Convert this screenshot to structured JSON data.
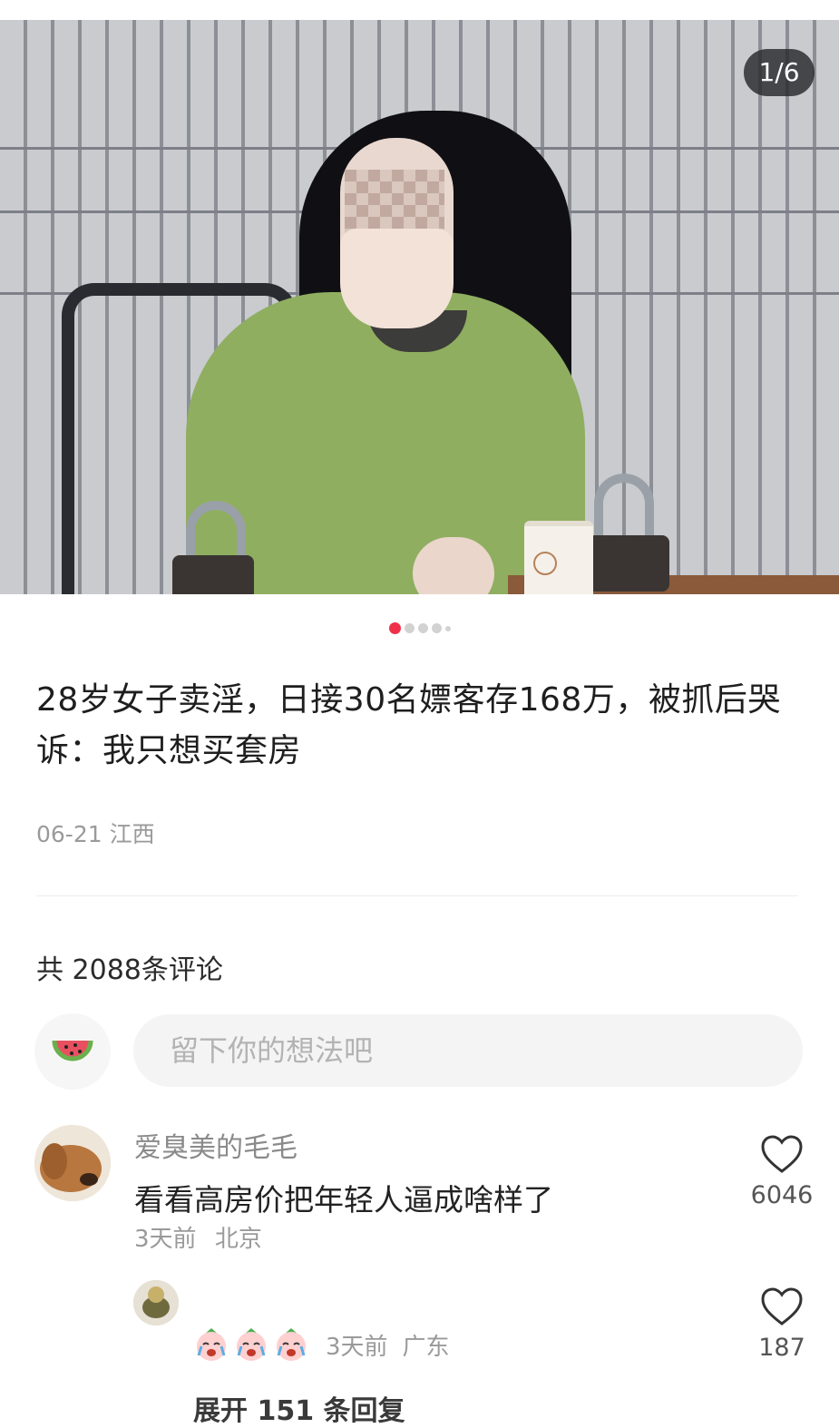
{
  "gallery": {
    "counter": "1/6",
    "dots": [
      true,
      false,
      false,
      false,
      false
    ]
  },
  "post": {
    "title": "28岁女子卖淫，日接30名嫖客存168万，被抓后哭诉：我只想买套房",
    "date": "06-21",
    "location": "江西"
  },
  "comments_header": {
    "count_text": "共 2088条评论"
  },
  "comment_input": {
    "placeholder": "留下你的想法吧"
  },
  "comments": [
    {
      "username": "爱臭美的毛毛",
      "text": "看看高房价把年轻人逼成啥样了",
      "time": "3天前",
      "location": "北京",
      "likes": "6046"
    }
  ],
  "reply": {
    "emojis": [
      "crying-face-emoji",
      "crying-face-emoji",
      "crying-face-emoji"
    ],
    "time": "3天前",
    "location": "广东",
    "likes": "187"
  },
  "expand_replies": "展开 151 条回复",
  "colors": {
    "accent": "#f0304a",
    "text_secondary": "#9a9a9a",
    "input_bg": "#f4f4f4"
  }
}
